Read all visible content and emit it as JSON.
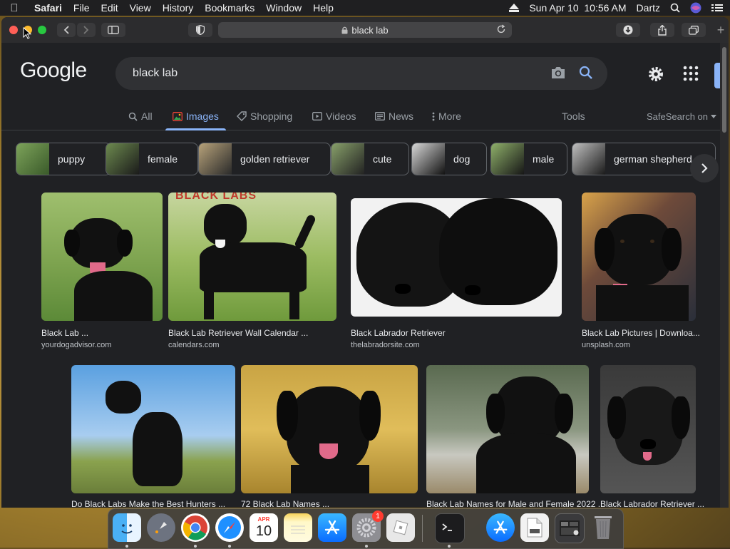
{
  "menubar": {
    "app_name": "Safari",
    "items": [
      "File",
      "Edit",
      "View",
      "History",
      "Bookmarks",
      "Window",
      "Help"
    ],
    "datetime": "Sun Apr 10  10:56 AM",
    "user": "Dartz"
  },
  "browser": {
    "url": "black lab"
  },
  "google": {
    "logo": "Google",
    "query": "black lab",
    "tabs": [
      "All",
      "Images",
      "Shopping",
      "Videos",
      "News",
      "More"
    ],
    "active_tab": "Images",
    "tools": "Tools",
    "safesearch": "SafeSearch on"
  },
  "chips": [
    "puppy",
    "female",
    "golden retriever",
    "cute",
    "dog",
    "male",
    "german shepherd"
  ],
  "results": [
    {
      "title": "Black Lab ...",
      "source": "yourdogadvisor.com"
    },
    {
      "title": "Black Lab Retriever Wall Calendar ...",
      "source": "calendars.com",
      "banner": "BLACK LABS"
    },
    {
      "title": "Black Labrador Retriever",
      "source": "thelabradorsite.com"
    },
    {
      "title": "Black Lab Pictures | Downloa...",
      "source": "unsplash.com"
    },
    {
      "title": "Do Black Labs Make the Best Hunters ...",
      "source": ""
    },
    {
      "title": "72 Black Lab Names ...",
      "source": ""
    },
    {
      "title": "Black Lab Names for Male and Female 2022 ...",
      "source": ""
    },
    {
      "title": "Black Labrador Retriever ...",
      "source": ""
    }
  ],
  "dock": {
    "calendar_month": "APR",
    "calendar_day": "10",
    "settings_badge": "1"
  },
  "colors": {
    "page_bg": "#202124",
    "accent": "#8ab4f8",
    "chip_border": "#5f6368"
  }
}
